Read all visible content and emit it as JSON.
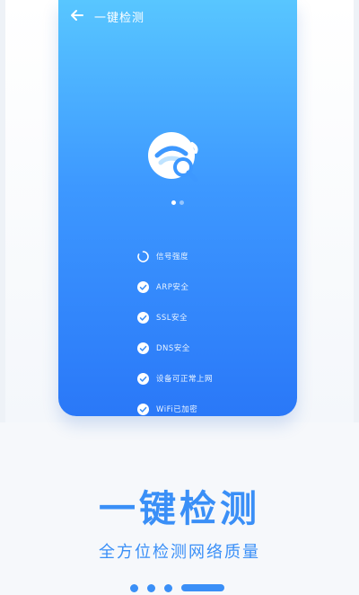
{
  "phone": {
    "title": "一键检测",
    "pager": {
      "active_index": 0,
      "count": 2
    }
  },
  "checklist": [
    {
      "label": "信号强度",
      "status": "loading",
      "icon": "spinner-icon"
    },
    {
      "label": "ARP安全",
      "status": "done",
      "icon": "check-circle-icon"
    },
    {
      "label": "SSL安全",
      "status": "done",
      "icon": "check-circle-icon"
    },
    {
      "label": "DNS安全",
      "status": "done",
      "icon": "check-circle-icon"
    },
    {
      "label": "设备可正常上网",
      "status": "done",
      "icon": "check-circle-icon"
    },
    {
      "label": "WiFi已加密",
      "status": "done",
      "icon": "check-circle-icon"
    }
  ],
  "promo": {
    "headline": "一键检测",
    "subline": "全方位检测网络质量",
    "pager": {
      "active_index": 3,
      "count": 4
    }
  },
  "colors": {
    "gradient_top": "#58c6ff",
    "gradient_bottom": "#2a78f8",
    "accent": "#3a8ff7",
    "text_on_blue": "#ffffff"
  }
}
